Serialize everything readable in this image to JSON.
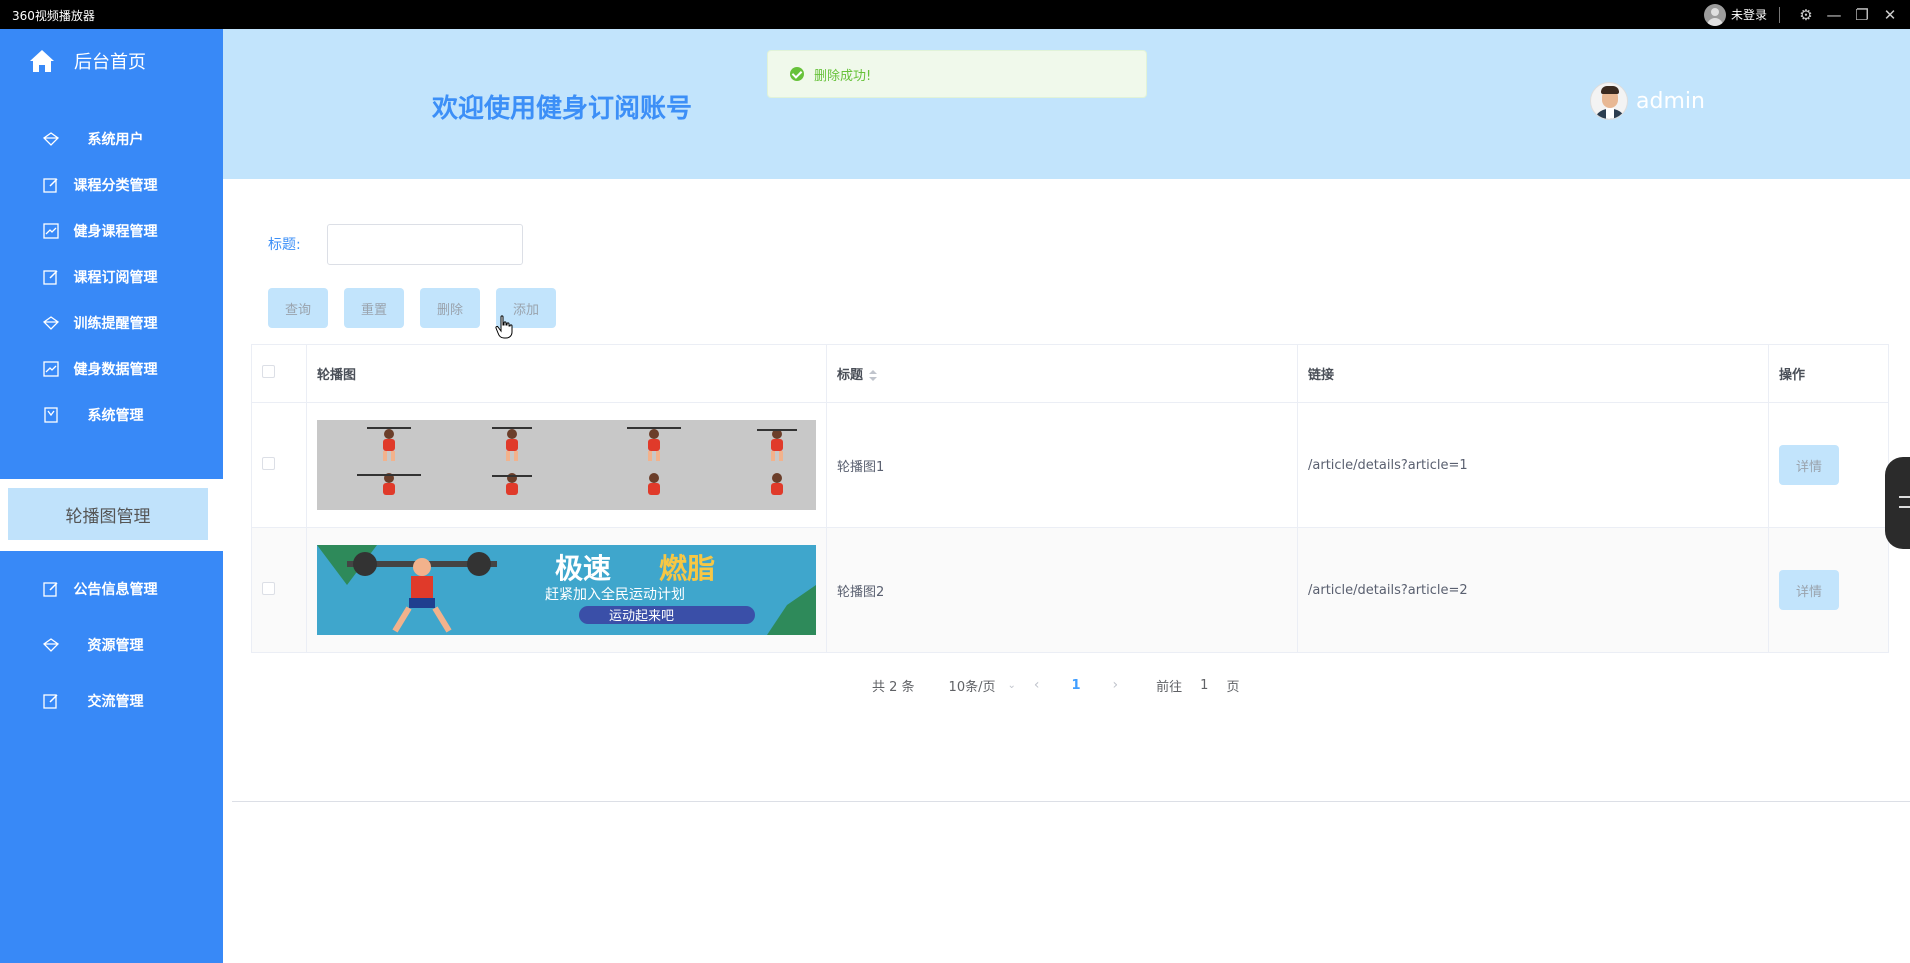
{
  "window": {
    "app_title": "360视频播放器",
    "login_text": "未登录",
    "controls": {
      "settings": "⚙",
      "minimize": "—",
      "restore": "❐",
      "close": "✕"
    }
  },
  "sidebar": {
    "home_label": "后台首页",
    "items": [
      {
        "label": "系统用户",
        "icon": "diamond-icon"
      },
      {
        "label": "课程分类管理",
        "icon": "edit-icon"
      },
      {
        "label": "健身课程管理",
        "icon": "chart-icon"
      },
      {
        "label": "课程订阅管理",
        "icon": "edit-icon"
      },
      {
        "label": "训练提醒管理",
        "icon": "diamond-icon"
      },
      {
        "label": "健身数据管理",
        "icon": "chart-icon"
      },
      {
        "label": "系统管理",
        "icon": "bookmark-icon"
      },
      {
        "label": "轮播图管理",
        "icon": "",
        "active": true
      },
      {
        "label": "公告信息管理",
        "icon": "edit-icon"
      },
      {
        "label": "资源管理",
        "icon": "diamond-icon"
      },
      {
        "label": "交流管理",
        "icon": "edit-icon"
      }
    ]
  },
  "header": {
    "welcome": "欢迎使用健身订阅账号",
    "username": "admin"
  },
  "toast": {
    "message": "删除成功!"
  },
  "search": {
    "title_label": "标题:",
    "title_value": "",
    "buttons": {
      "query": "查询",
      "reset": "重置",
      "delete": "删除",
      "add": "添加"
    }
  },
  "table": {
    "headers": {
      "image": "轮播图",
      "title": "标题",
      "link": "链接",
      "action": "操作"
    },
    "rows": [
      {
        "title": "轮播图1",
        "link": "/article/details?article=1",
        "action": "详情",
        "image_text": ""
      },
      {
        "title": "轮播图2",
        "link": "/article/details?article=2",
        "action": "详情",
        "image_text": {
          "big1": "极速",
          "big2": "燃脂",
          "sub": "赶紧加入全民运动计划",
          "badge": "运动起来吧"
        }
      }
    ]
  },
  "pagination": {
    "total": "共 2 条",
    "page_size": "10条/页",
    "current": "1",
    "goto_label": "前往",
    "goto_value": "1",
    "page_suffix": "页"
  },
  "colors": {
    "sidebar": "#3889f7",
    "header": "#c2e4fc",
    "accent": "#3c8ff7",
    "success": "#67c23a"
  }
}
